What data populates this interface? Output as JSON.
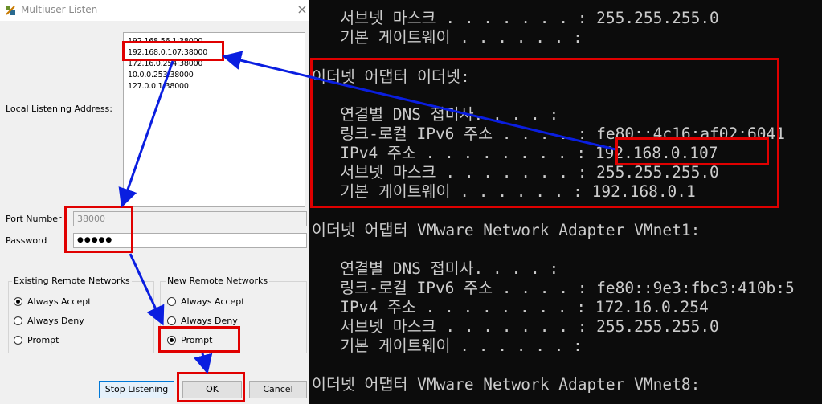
{
  "dialog": {
    "title": "Multiuser Listen",
    "close_glyph": "×",
    "local_address_label": "Local Listening Address:",
    "addresses": [
      "192.168.56.1:38000",
      "192.168.0.107:38000",
      "172.16.0.254:38000",
      "10.0.0.253:38000",
      "127.0.0.1:38000"
    ],
    "port_label": "Port Number",
    "port_value": "38000",
    "password_label": "Password",
    "password_value": "●●●●●",
    "existing_group": {
      "title": "Existing Remote Networks",
      "options": [
        "Always Accept",
        "Always Deny",
        "Prompt"
      ],
      "selected": "Always Accept"
    },
    "new_group": {
      "title": "New Remote Networks",
      "options": [
        "Always Accept",
        "Always Deny",
        "Prompt"
      ],
      "selected": "Prompt"
    },
    "buttons": {
      "stop": "Stop Listening",
      "ok": "OK",
      "cancel": "Cancel"
    }
  },
  "terminal": {
    "lines": [
      "   서브넷 마스크 . . . . . . . : 255.255.255.0",
      "   기본 게이트웨이 . . . . . . :",
      "",
      "이더넷 어댑터 이더넷:",
      "",
      "   연결별 DNS 접미사. . . . :",
      "   링크-로컬 IPv6 주소 . . . . : fe80::4c16:af02:6041",
      "   IPv4 주소 . . . . . . . . : 192.168.0.107",
      "   서브넷 마스크 . . . . . . . : 255.255.255.0",
      "   기본 게이트웨이 . . . . . . : 192.168.0.1",
      "",
      "이더넷 어댑터 VMware Network Adapter VMnet1:",
      "",
      "   연결별 DNS 접미사. . . . :",
      "   링크-로컬 IPv6 주소 . . . . : fe80::9e3:fbc3:410b:5",
      "   IPv4 주소 . . . . . . . . : 172.16.0.254",
      "   서브넷 마스크 . . . . . . . : 255.255.255.0",
      "   기본 게이트웨이 . . . . . . :",
      "",
      "이더넷 어댑터 VMware Network Adapter VMnet8:"
    ]
  },
  "colors": {
    "annotation_box": "#e00000",
    "annotation_arrow": "#0a1ee0",
    "terminal_bg": "#0c0c0c",
    "terminal_text": "#cccccc",
    "dialog_bg": "#f0f0f0"
  }
}
